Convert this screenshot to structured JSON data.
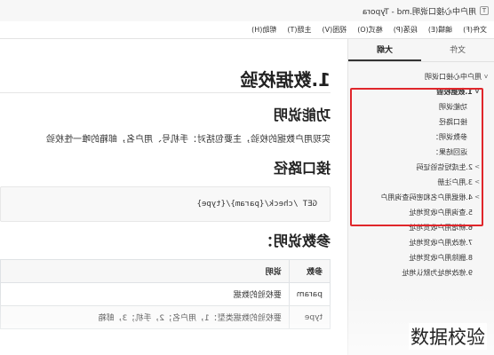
{
  "window": {
    "title": "用户中心接口说明.md - Typora",
    "app_icon": "T"
  },
  "menu": [
    "文件(F)",
    "编辑(E)",
    "段落(P)",
    "格式(O)",
    "视图(V)",
    "主题(T)",
    "帮助(H)"
  ],
  "sidebar": {
    "tabs": [
      "文件",
      "大纲"
    ],
    "active_tab": "大纲",
    "outline": [
      {
        "label": "用户中心接口说明",
        "level": 1,
        "caret": "v"
      },
      {
        "label": "1.数据校验",
        "level": 2,
        "caret": "v",
        "bold": true
      },
      {
        "label": "功能说明",
        "level": 3
      },
      {
        "label": "接口路径",
        "level": 3
      },
      {
        "label": "参数说明：",
        "level": 3
      },
      {
        "label": "返回结果：",
        "level": 3
      },
      {
        "label": "2.生成短信验证码",
        "level": 2,
        "caret": ">"
      },
      {
        "label": "3.用户注册",
        "level": 2,
        "caret": ">"
      },
      {
        "label": "4.根据用户名和密码查询用户",
        "level": 2,
        "caret": ">"
      },
      {
        "label": "5.查询用户收货地址",
        "level": 2
      },
      {
        "label": "6.新增用户收货地址",
        "level": 2
      },
      {
        "label": "7.修改用户收货地址",
        "level": 2
      },
      {
        "label": "8.删除用户收货地址",
        "level": 2
      },
      {
        "label": "9.修改地址为默认地址",
        "level": 2
      }
    ]
  },
  "document": {
    "h1": "1.数据校验",
    "section1_title": "功能说明",
    "section1_text": "实现用户数据的校验，主要包括对：手机号、用户名，邮箱的唯一性校验",
    "section2_title": "接口路径",
    "code": "GET /check/{param}/{type}",
    "section3_title": "参数说明：",
    "table": {
      "headers": [
        "参数",
        "说明"
      ],
      "rows": [
        [
          "param",
          "要校验的数据"
        ],
        [
          "type",
          "要校验的数据类型：1，用户名；2，手机；3，邮箱"
        ]
      ]
    }
  },
  "caption": "数据校验",
  "colors": {
    "highlight": "#e0262b",
    "sidebar_bg": "#f6f6f6"
  }
}
